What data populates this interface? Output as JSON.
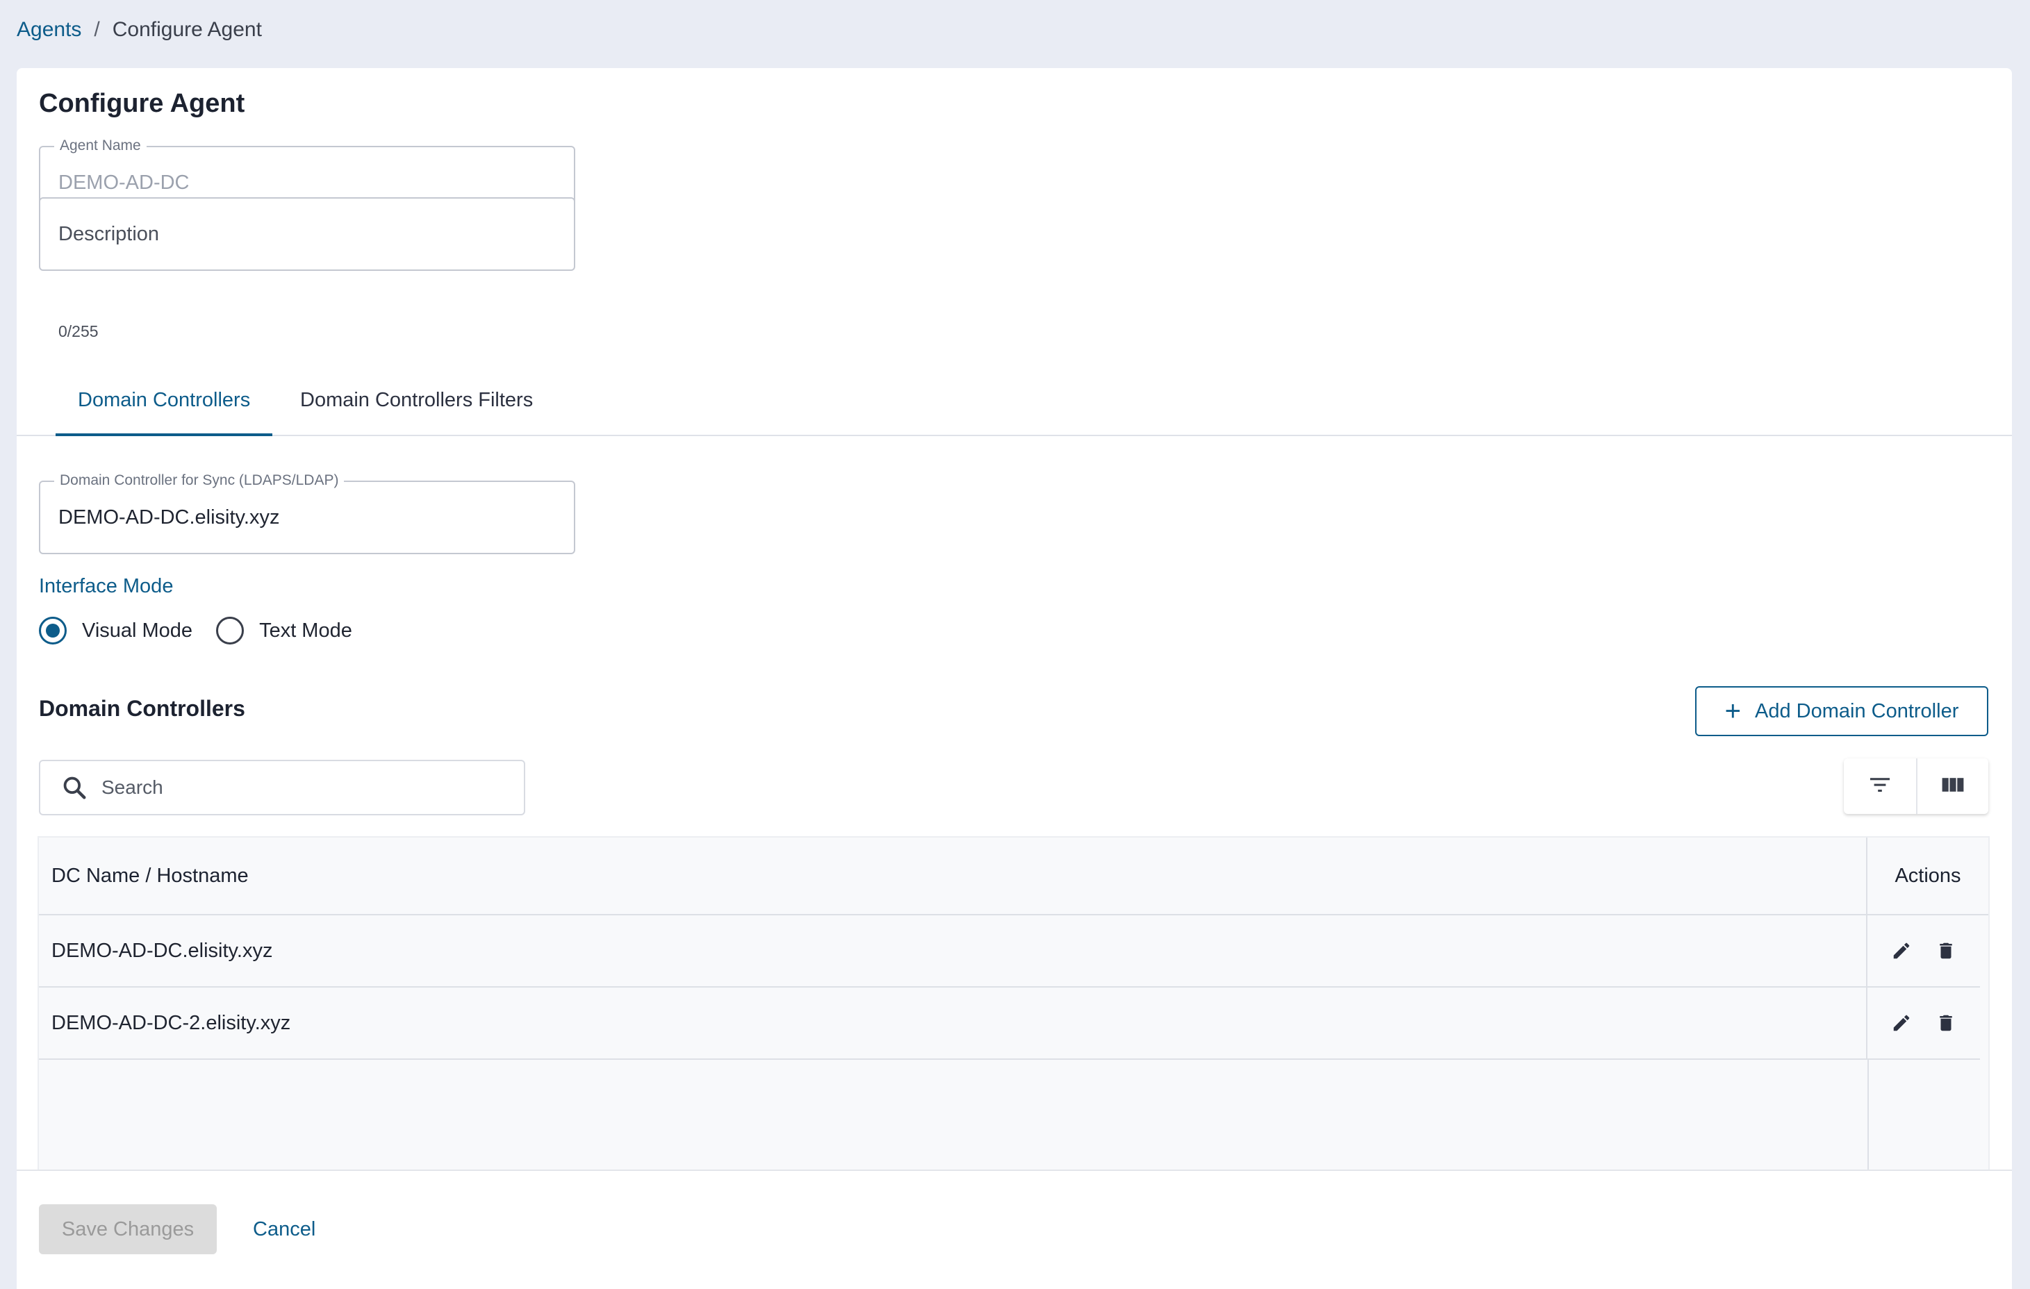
{
  "breadcrumb": {
    "parent": "Agents",
    "separator": "/",
    "current": "Configure Agent"
  },
  "page": {
    "title": "Configure Agent"
  },
  "form": {
    "agent_name": {
      "label": "Agent Name",
      "value": "DEMO-AD-DC"
    },
    "description": {
      "placeholder": "Description",
      "counter": "0/255"
    }
  },
  "tabs": [
    {
      "label": "Domain Controllers",
      "active": true
    },
    {
      "label": "Domain Controllers Filters",
      "active": false
    }
  ],
  "sync": {
    "label": "Domain Controller for Sync (LDAPS/LDAP)",
    "value": "DEMO-AD-DC.elisity.xyz"
  },
  "interface_mode": {
    "label": "Interface Mode",
    "options": [
      {
        "label": "Visual Mode",
        "checked": true
      },
      {
        "label": "Text Mode",
        "checked": false
      }
    ]
  },
  "domain_controllers": {
    "heading": "Domain Controllers",
    "add_button": "Add Domain Controller",
    "search_placeholder": "Search",
    "columns": {
      "name": "DC Name / Hostname",
      "actions": "Actions"
    },
    "rows": [
      {
        "name": "DEMO-AD-DC.elisity.xyz"
      },
      {
        "name": "DEMO-AD-DC-2.elisity.xyz"
      }
    ]
  },
  "footer": {
    "save": "Save Changes",
    "cancel": "Cancel"
  },
  "colors": {
    "accent": "#0d5c8a",
    "background": "#e9ecf4",
    "disabled_button": "#dcdcdc"
  },
  "icons": {
    "search": "search-icon",
    "filter": "filter-icon",
    "columns": "columns-icon",
    "edit": "pencil-icon",
    "delete": "trash-icon",
    "add": "plus-icon"
  }
}
